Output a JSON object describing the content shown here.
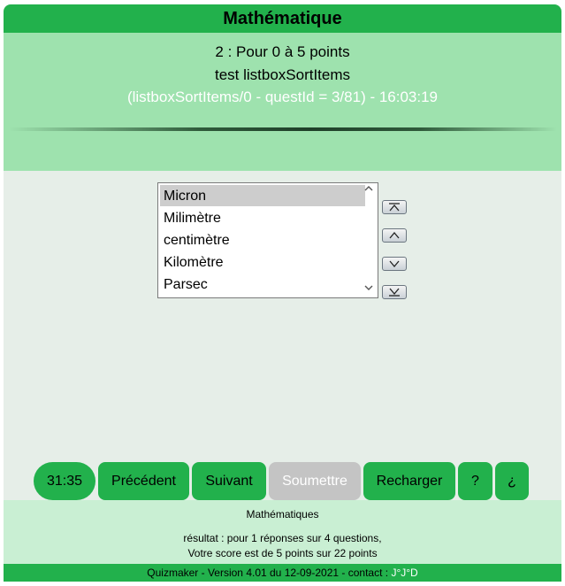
{
  "title": "Mathématique",
  "question": {
    "line1": "2 : Pour 0 à 5 points",
    "line2": "test listboxSortItems",
    "line3": "(listboxSortItems/0 - questId = 3/81) - 16:03:19"
  },
  "listbox": {
    "items": [
      "Micron",
      "Milimètre",
      "centimètre",
      "Kilomètre",
      "Parsec"
    ],
    "selected": "Micron"
  },
  "move_buttons": [
    "move-top",
    "move-up",
    "move-down",
    "move-bottom"
  ],
  "toolbar": {
    "timer": "31:35",
    "previous": "Précédent",
    "next": "Suivant",
    "submit": "Soumettre",
    "reload": "Recharger",
    "help": "?",
    "info": "¿"
  },
  "footer": {
    "subject": "Mathématiques",
    "result_line1": "résultat : pour 1 réponses sur 4 questions,",
    "result_line2": "Votre score est de 5 points sur 22 points",
    "version": "Quizmaker - Version 4.01 du 12-09-2021 - contact : ",
    "contact": "J°J°D"
  },
  "colors": {
    "green": "#22b14c",
    "header_bg": "#9ee2ae",
    "main_bg": "#e6eee8",
    "footer_bg": "#c9efd3",
    "disabled": "#c4c4c4"
  }
}
